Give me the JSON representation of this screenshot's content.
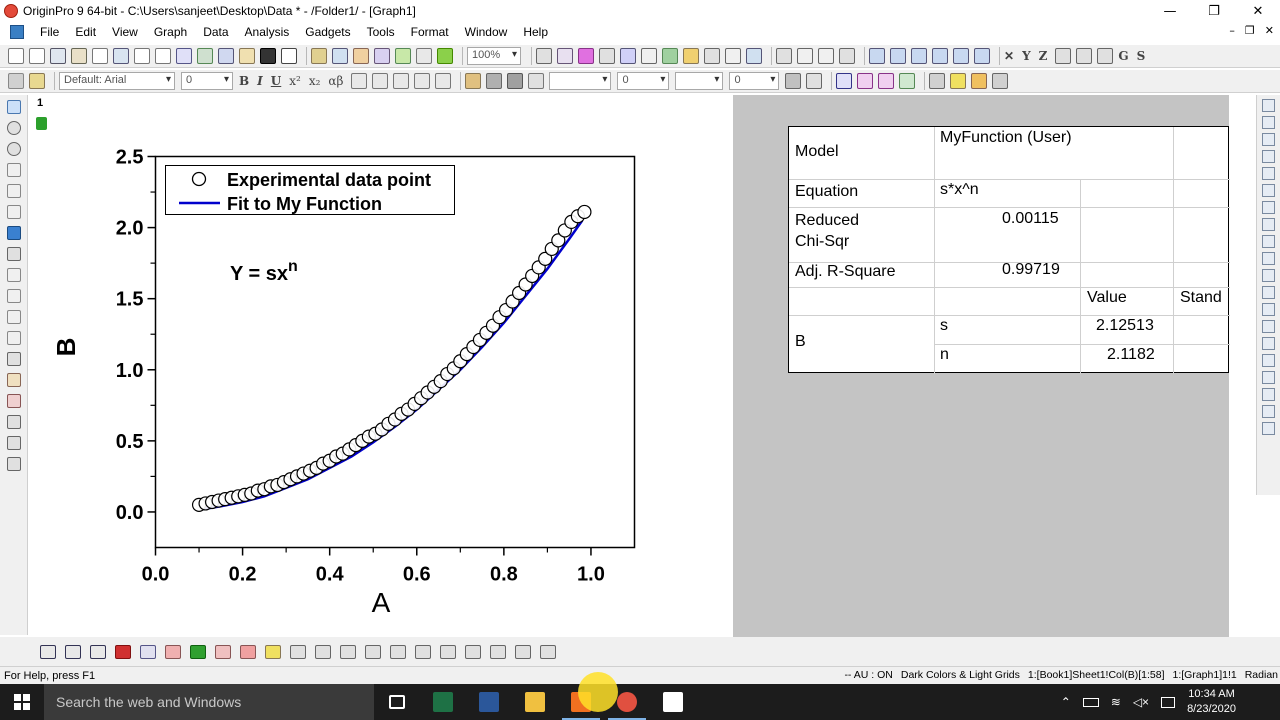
{
  "window": {
    "title": "OriginPro 9 64-bit - C:\\Users\\sanjeet\\Desktop\\Data * - /Folder1/ - [Graph1]",
    "minimize": "—",
    "maximize": "❐",
    "close": "✕"
  },
  "menu": {
    "items": [
      "File",
      "Edit",
      "View",
      "Graph",
      "Data",
      "Analysis",
      "Gadgets",
      "Tools",
      "Format",
      "Window",
      "Help"
    ],
    "mdi_min": "–",
    "mdi_restore": "❐",
    "mdi_close": "✕"
  },
  "toolbar1": {
    "zoom": "100%"
  },
  "toolbar2": {
    "font_name": "Default: Arial",
    "font_size": "0",
    "bold": "B",
    "italic": "I",
    "underline": "U",
    "superscript": "x²",
    "subscript": "x₂",
    "greek": "αβ",
    "line_width": "0",
    "border_width": "0"
  },
  "graph": {
    "layer_number": "1",
    "equation_label": "Y = sx",
    "equation_exponent": "n"
  },
  "chart_data": {
    "type": "scatter",
    "xlabel": "A",
    "ylabel": "B",
    "xlim": [
      0.0,
      1.1
    ],
    "ylim": [
      -0.25,
      2.5
    ],
    "xticks": [
      0.0,
      0.2,
      0.4,
      0.6,
      0.8,
      1.0
    ],
    "yticks": [
      0.0,
      0.5,
      1.0,
      1.5,
      2.0,
      2.5
    ],
    "xtick_labels": [
      "0.0",
      "0.2",
      "0.4",
      "0.6",
      "0.8",
      "1.0"
    ],
    "ytick_labels": [
      "0.0",
      "0.5",
      "1.0",
      "1.5",
      "2.0",
      "2.5"
    ],
    "grid": false,
    "legend_position": "top-left",
    "series": [
      {
        "name": "Experimental data point",
        "style": "open-circle",
        "color": "#000000",
        "x": [
          0.1,
          0.115,
          0.13,
          0.145,
          0.16,
          0.175,
          0.19,
          0.205,
          0.22,
          0.235,
          0.25,
          0.265,
          0.28,
          0.295,
          0.31,
          0.325,
          0.34,
          0.355,
          0.37,
          0.385,
          0.4,
          0.415,
          0.43,
          0.445,
          0.46,
          0.475,
          0.49,
          0.505,
          0.52,
          0.535,
          0.55,
          0.565,
          0.58,
          0.595,
          0.61,
          0.625,
          0.64,
          0.655,
          0.67,
          0.685,
          0.7,
          0.715,
          0.73,
          0.745,
          0.76,
          0.775,
          0.79,
          0.805,
          0.82,
          0.835,
          0.85,
          0.865,
          0.88,
          0.895,
          0.91,
          0.925,
          0.94,
          0.955,
          0.97,
          0.985
        ],
        "y": [
          0.05,
          0.06,
          0.07,
          0.08,
          0.09,
          0.1,
          0.11,
          0.12,
          0.13,
          0.15,
          0.16,
          0.18,
          0.19,
          0.21,
          0.23,
          0.25,
          0.27,
          0.29,
          0.31,
          0.34,
          0.36,
          0.39,
          0.41,
          0.44,
          0.47,
          0.5,
          0.53,
          0.55,
          0.58,
          0.62,
          0.65,
          0.69,
          0.72,
          0.76,
          0.8,
          0.84,
          0.88,
          0.92,
          0.97,
          1.01,
          1.06,
          1.11,
          1.16,
          1.21,
          1.26,
          1.31,
          1.37,
          1.42,
          1.48,
          1.54,
          1.6,
          1.66,
          1.72,
          1.78,
          1.85,
          1.91,
          1.98,
          2.04,
          2.08,
          2.11
        ]
      },
      {
        "name": "Fit to My Function",
        "style": "line",
        "color": "#0000cc",
        "x": [
          0.11,
          0.15,
          0.2,
          0.25,
          0.3,
          0.35,
          0.4,
          0.45,
          0.5,
          0.55,
          0.6,
          0.65,
          0.7,
          0.75,
          0.8,
          0.85,
          0.9,
          0.95,
          0.98
        ],
        "y": [
          0.02,
          0.04,
          0.07,
          0.11,
          0.17,
          0.23,
          0.31,
          0.39,
          0.49,
          0.6,
          0.72,
          0.86,
          1.0,
          1.16,
          1.33,
          1.52,
          1.71,
          1.92,
          2.05
        ]
      }
    ]
  },
  "results": {
    "model_label": "Model",
    "model_value": "MyFunction (User)",
    "equation_label": "Equation",
    "equation_value": "s*x^n",
    "chisqr_label_1": "Reduced",
    "chisqr_label_2": "Chi-Sqr",
    "chisqr_value": "0.00115",
    "rsq_label": "Adj. R-Square",
    "rsq_value": "0.99719",
    "col_value": "Value",
    "col_std": "Stand",
    "param_group": "B",
    "param_s": "s",
    "param_s_value": "2.12513",
    "param_n": "n",
    "param_n_value": "2.1182"
  },
  "statusbar": {
    "help": "For Help, press F1",
    "au": "-- AU : ON",
    "theme": "Dark Colors & Light Grids",
    "book": "1:[Book1]Sheet1!Col(B)[1:58]",
    "graph": "1:[Graph1]1!1",
    "units": "Radian"
  },
  "taskbar": {
    "search_placeholder": "Search the web and Windows",
    "time": "10:34 AM",
    "date": "8/23/2020"
  }
}
